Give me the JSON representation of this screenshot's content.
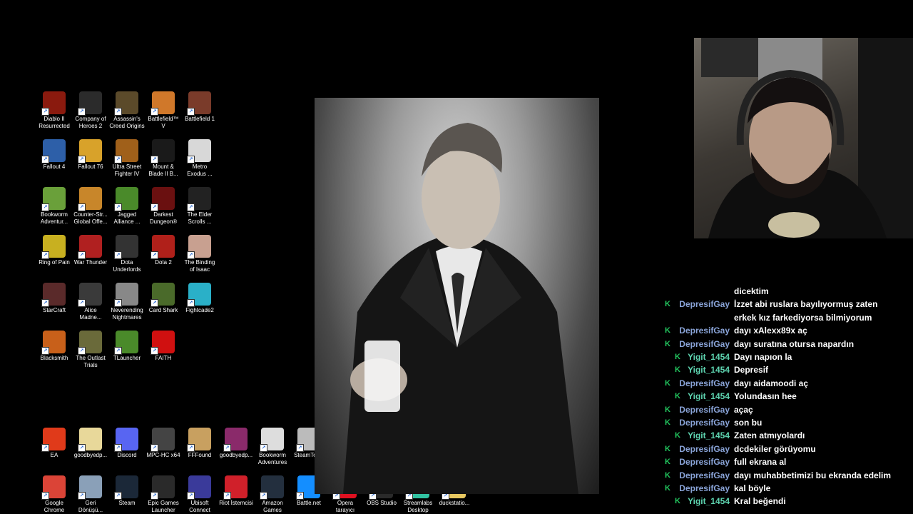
{
  "desktop_icons": [
    {
      "label": "Diablo II\nResurrected",
      "icon": "diablo-icon",
      "color": "#8a1a0e"
    },
    {
      "label": "Company of\nHeroes 2",
      "icon": "coh2-icon",
      "color": "#2b2b2b"
    },
    {
      "label": "Assassin's\nCreed Origins",
      "icon": "assassins-creed-icon",
      "color": "#5b4a2a"
    },
    {
      "label": "Battlefield™ V",
      "icon": "battlefield-v-icon",
      "color": "#d0782a"
    },
    {
      "label": "Battlefield 1",
      "icon": "battlefield-1-icon",
      "color": "#7a3b2a"
    },
    {
      "label": "Fallout 4",
      "icon": "fallout-4-icon",
      "color": "#2d5fa8"
    },
    {
      "label": "Fallout 76",
      "icon": "fallout-76-icon",
      "color": "#d8a22a"
    },
    {
      "label": "Ultra Street\nFighter IV",
      "icon": "street-fighter-icon",
      "color": "#a0601a"
    },
    {
      "label": "Mount &\nBlade II B...",
      "icon": "mount-blade-icon",
      "color": "#1a1a1a"
    },
    {
      "label": "Metro\nExodus ...",
      "icon": "metro-exodus-icon",
      "color": "#d8d8d8"
    },
    {
      "label": "Bookworm\nAdventur...",
      "icon": "bookworm-icon",
      "color": "#6aa03a"
    },
    {
      "label": "Counter-Str...\nGlobal Offe...",
      "icon": "csgo-icon",
      "color": "#c8862a"
    },
    {
      "label": "Jagged\nAlliance ...",
      "icon": "jagged-alliance-icon",
      "color": "#4a8a2a"
    },
    {
      "label": "Darkest\nDungeon®",
      "icon": "darkest-dungeon-icon",
      "color": "#6a1010"
    },
    {
      "label": "The Elder\nScrolls ...",
      "icon": "elder-scrolls-icon",
      "color": "#222"
    },
    {
      "label": "Ring of Pain",
      "icon": "ring-of-pain-icon",
      "color": "#c8b020"
    },
    {
      "label": "War Thunder",
      "icon": "war-thunder-icon",
      "color": "#b02020"
    },
    {
      "label": "Dota\nUnderlords",
      "icon": "dota-underlords-icon",
      "color": "#333"
    },
    {
      "label": "Dota 2",
      "icon": "dota-2-icon",
      "color": "#b0201a"
    },
    {
      "label": "The Binding\nof Isaac",
      "icon": "binding-of-isaac-icon",
      "color": "#c8a090"
    },
    {
      "label": "StarCraft",
      "icon": "starcraft-icon",
      "color": "#5a2a2a"
    },
    {
      "label": "Alice\nMadne...",
      "icon": "alice-icon",
      "color": "#3a3a3a"
    },
    {
      "label": "Neverending\nNightmares",
      "icon": "neverending-nightmares-icon",
      "color": "#888"
    },
    {
      "label": "Card Shark",
      "icon": "card-shark-icon",
      "color": "#4a6a2a"
    },
    {
      "label": "Fightcade2",
      "icon": "fightcade-icon",
      "color": "#2ab0c8"
    },
    {
      "label": "Blacksmith",
      "icon": "blacksmith-icon",
      "color": "#c8601a"
    },
    {
      "label": "The Outlast\nTrials",
      "icon": "outlast-icon",
      "color": "#6a6a3a"
    },
    {
      "label": "TLauncher",
      "icon": "tlauncher-icon",
      "color": "#4a8a2a"
    },
    {
      "label": "FAITH",
      "icon": "faith-icon",
      "color": "#d01010"
    }
  ],
  "bottom_icons_row1": [
    {
      "label": "EA",
      "icon": "ea-icon",
      "color": "#e03a1a"
    },
    {
      "label": "goodbyedp...",
      "icon": "file-icon",
      "color": "#e8d89a"
    },
    {
      "label": "Discord",
      "icon": "discord-icon",
      "color": "#5865f2"
    },
    {
      "label": "MPC-HC x64",
      "icon": "mpc-hc-icon",
      "color": "#444"
    },
    {
      "label": "FFFound",
      "icon": "ffound-icon",
      "color": "#c8a060"
    },
    {
      "label": "goodbyedp...",
      "icon": "winrar-icon",
      "color": "#8a2a6a"
    },
    {
      "label": "Bookworm\nAdventures",
      "icon": "bookworm-adventures-icon",
      "color": "#ddd"
    },
    {
      "label": "SteamTools",
      "icon": "steamtools-icon",
      "color": "#bbb"
    }
  ],
  "bottom_icons_row2": [
    {
      "label": "Google\nChrome",
      "icon": "chrome-icon",
      "color": "#db4437"
    },
    {
      "label": "Geri\nDönüşü...",
      "icon": "recycle-bin-icon",
      "color": "#8aa0b8"
    },
    {
      "label": "Steam",
      "icon": "steam-icon",
      "color": "#1b2838"
    },
    {
      "label": "Epic Games\nLauncher",
      "icon": "epic-games-icon",
      "color": "#2a2a2a"
    },
    {
      "label": "Ubisoft\nConnect",
      "icon": "ubisoft-icon",
      "color": "#3a3a9a"
    },
    {
      "label": "Riot İstemcisi",
      "icon": "riot-icon",
      "color": "#d0202a"
    },
    {
      "label": "Amazon\nGames",
      "icon": "amazon-games-icon",
      "color": "#232f3e"
    },
    {
      "label": "Battle.net",
      "icon": "battlenet-icon",
      "color": "#148eff"
    },
    {
      "label": "Opera\ntarayıcı",
      "icon": "opera-icon",
      "color": "#e01020"
    },
    {
      "label": "OBS Studio",
      "icon": "obs-icon",
      "color": "#2a2a2a"
    },
    {
      "label": "Streamlabs\nDesktop",
      "icon": "streamlabs-icon",
      "color": "#31c3a2"
    },
    {
      "label": "duckstatio...",
      "icon": "folder-icon",
      "color": "#e8c860"
    }
  ],
  "chat": {
    "user_color": "#8aa4d8",
    "user2_color": "#5ed4b0",
    "messages": [
      {
        "user": "",
        "text": "dicektim",
        "badge": false
      },
      {
        "user": "DepresifGay",
        "text": "İzzet abi ruslara bayılıyormuş zaten",
        "badge": true
      },
      {
        "user": "",
        "text": "erkek kız farkediyorsa bilmiyorum",
        "badge": false
      },
      {
        "user": "DepresifGay",
        "text": "dayı xAlexx89x aç",
        "badge": true
      },
      {
        "user": "DepresifGay",
        "text": "dayı suratına otursa napardın",
        "badge": true
      },
      {
        "user": "Yigit_1454",
        "text": "Dayı napıon la",
        "badge": true
      },
      {
        "user": "Yigit_1454",
        "text": "Depresif",
        "badge": true
      },
      {
        "user": "DepresifGay",
        "text": "dayı aidamoodi aç",
        "badge": true
      },
      {
        "user": "Yigit_1454",
        "text": "Yolundasın hee",
        "badge": true
      },
      {
        "user": "DepresifGay",
        "text": "açaç",
        "badge": true
      },
      {
        "user": "DepresifGay",
        "text": "son bu",
        "badge": true
      },
      {
        "user": "Yigit_1454",
        "text": "Zaten atmıyolardı",
        "badge": true
      },
      {
        "user": "DepresifGay",
        "text": "dcdekiler görüyomu",
        "badge": true
      },
      {
        "user": "DepresifGay",
        "text": "full ekrana al",
        "badge": true
      },
      {
        "user": "DepresifGay",
        "text": "dayı muhabbetimizi bu ekranda edelim",
        "badge": true
      },
      {
        "user": "DepresifGay",
        "text": "kal böyle",
        "badge": true
      },
      {
        "user": "Yigit_1454",
        "text": "Kral beğendi",
        "badge": true
      }
    ]
  },
  "wallpaper": {
    "icon": "portrait-photo-icon"
  },
  "webcam": {
    "icon": "webcam-feed-icon"
  }
}
